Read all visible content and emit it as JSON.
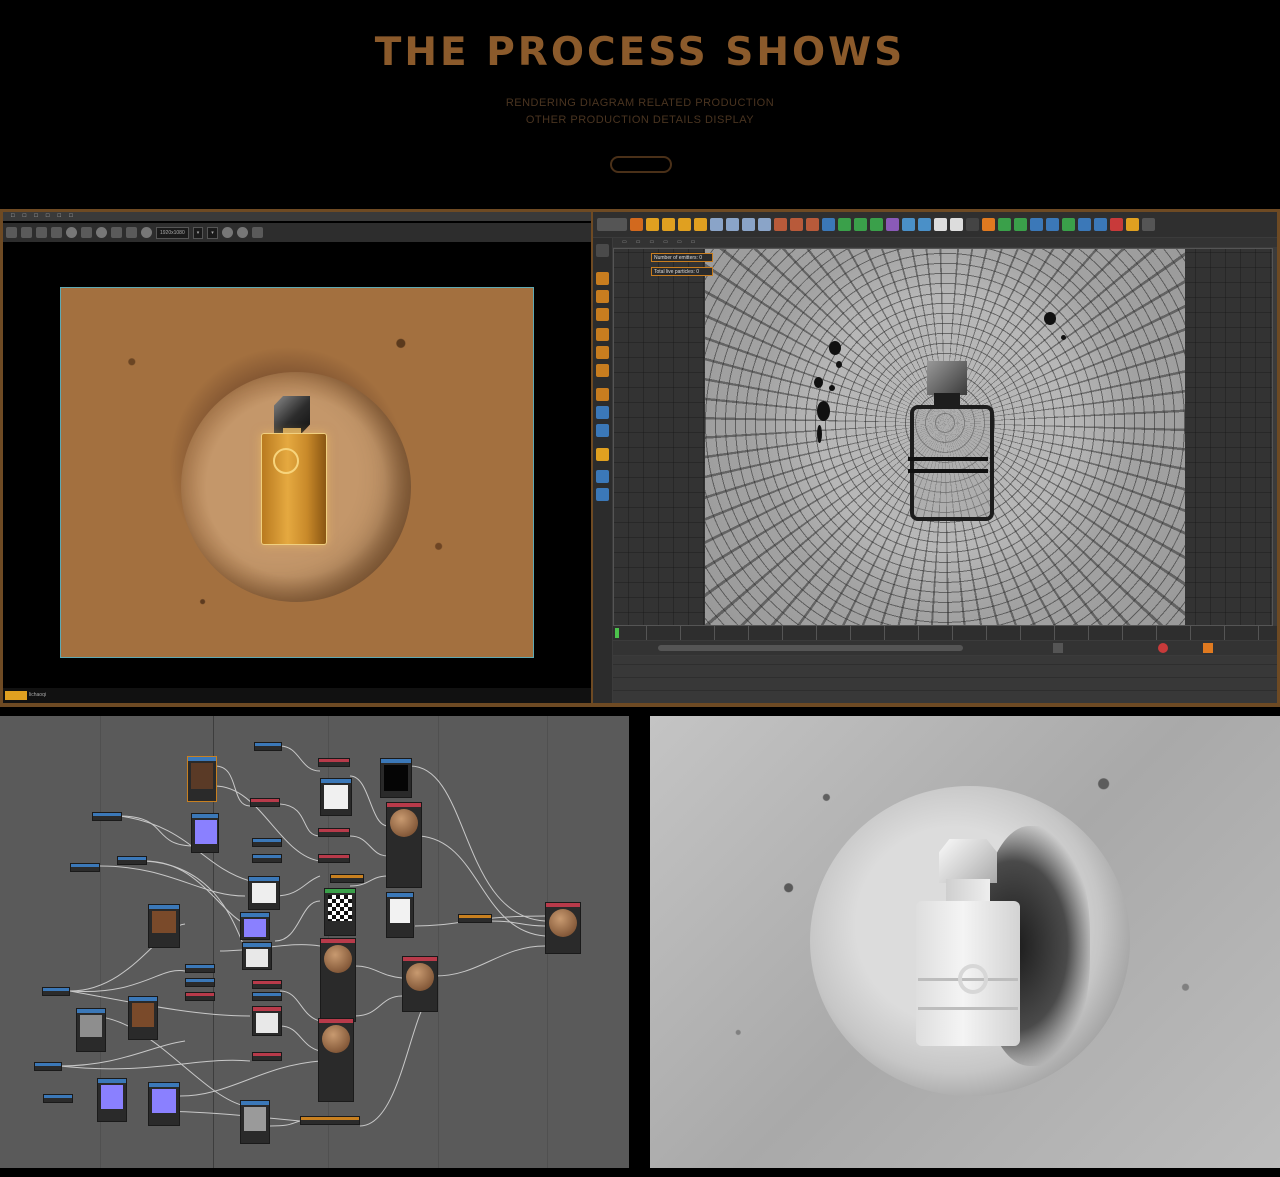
{
  "header": {
    "title": "THE PROCESS SHOWS",
    "subtitle_line1": "RENDERING DIAGRAM RELATED PRODUCTION",
    "subtitle_line2": "OTHER PRODUCTION DETAILS DISPLAY"
  },
  "render_view": {
    "toolbar_field": "1920x1080",
    "status_label": "lichaoqi"
  },
  "viewport_3d": {
    "tooltip_1": "Number of emitters: 0",
    "tooltip_2": "Total live particles: 0"
  },
  "colors": {
    "accent_gold": "#8b5a2b",
    "frame_border": "#6e4a23",
    "tooltip_border": "#c87d1f",
    "node_header_red": "#b83a4a",
    "node_header_blue": "#3b78b8",
    "node_header_green": "#3aa04a",
    "wire": "#c8c8c8"
  },
  "icons": {
    "render_toolbar": [
      "settings-gear-icon",
      "refresh-icon",
      "pause-icon",
      "stop-icon",
      "lock-icon",
      "sphere-icon"
    ],
    "viewport_toolbar": [
      "undo-icon",
      "move-icon",
      "scale-icon",
      "rotate-icon",
      "x-axis-icon",
      "y-axis-icon",
      "z-axis-icon",
      "render-icon",
      "cube-icon",
      "camera-icon",
      "light-icon"
    ],
    "playback": [
      "play-icon",
      "record-icon",
      "keyframe-icon"
    ]
  }
}
